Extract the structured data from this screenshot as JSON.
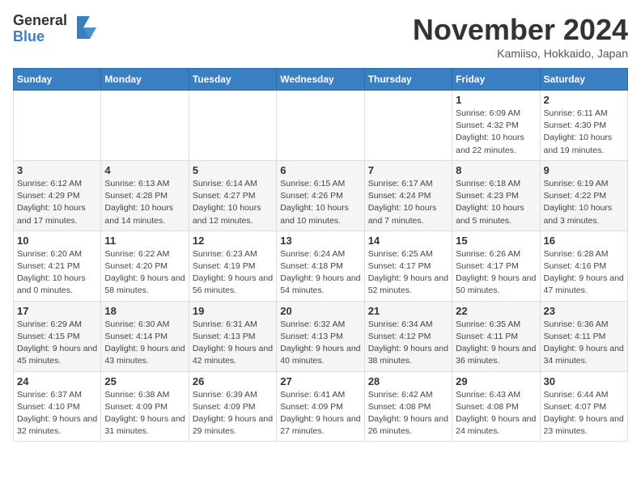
{
  "logo": {
    "general": "General",
    "blue": "Blue"
  },
  "title": "November 2024",
  "location": "Kamiiso, Hokkaido, Japan",
  "days_header": [
    "Sunday",
    "Monday",
    "Tuesday",
    "Wednesday",
    "Thursday",
    "Friday",
    "Saturday"
  ],
  "weeks": [
    [
      {
        "day": "",
        "info": ""
      },
      {
        "day": "",
        "info": ""
      },
      {
        "day": "",
        "info": ""
      },
      {
        "day": "",
        "info": ""
      },
      {
        "day": "",
        "info": ""
      },
      {
        "day": "1",
        "info": "Sunrise: 6:09 AM\nSunset: 4:32 PM\nDaylight: 10 hours and 22 minutes."
      },
      {
        "day": "2",
        "info": "Sunrise: 6:11 AM\nSunset: 4:30 PM\nDaylight: 10 hours and 19 minutes."
      }
    ],
    [
      {
        "day": "3",
        "info": "Sunrise: 6:12 AM\nSunset: 4:29 PM\nDaylight: 10 hours and 17 minutes."
      },
      {
        "day": "4",
        "info": "Sunrise: 6:13 AM\nSunset: 4:28 PM\nDaylight: 10 hours and 14 minutes."
      },
      {
        "day": "5",
        "info": "Sunrise: 6:14 AM\nSunset: 4:27 PM\nDaylight: 10 hours and 12 minutes."
      },
      {
        "day": "6",
        "info": "Sunrise: 6:15 AM\nSunset: 4:26 PM\nDaylight: 10 hours and 10 minutes."
      },
      {
        "day": "7",
        "info": "Sunrise: 6:17 AM\nSunset: 4:24 PM\nDaylight: 10 hours and 7 minutes."
      },
      {
        "day": "8",
        "info": "Sunrise: 6:18 AM\nSunset: 4:23 PM\nDaylight: 10 hours and 5 minutes."
      },
      {
        "day": "9",
        "info": "Sunrise: 6:19 AM\nSunset: 4:22 PM\nDaylight: 10 hours and 3 minutes."
      }
    ],
    [
      {
        "day": "10",
        "info": "Sunrise: 6:20 AM\nSunset: 4:21 PM\nDaylight: 10 hours and 0 minutes."
      },
      {
        "day": "11",
        "info": "Sunrise: 6:22 AM\nSunset: 4:20 PM\nDaylight: 9 hours and 58 minutes."
      },
      {
        "day": "12",
        "info": "Sunrise: 6:23 AM\nSunset: 4:19 PM\nDaylight: 9 hours and 56 minutes."
      },
      {
        "day": "13",
        "info": "Sunrise: 6:24 AM\nSunset: 4:18 PM\nDaylight: 9 hours and 54 minutes."
      },
      {
        "day": "14",
        "info": "Sunrise: 6:25 AM\nSunset: 4:17 PM\nDaylight: 9 hours and 52 minutes."
      },
      {
        "day": "15",
        "info": "Sunrise: 6:26 AM\nSunset: 4:17 PM\nDaylight: 9 hours and 50 minutes."
      },
      {
        "day": "16",
        "info": "Sunrise: 6:28 AM\nSunset: 4:16 PM\nDaylight: 9 hours and 47 minutes."
      }
    ],
    [
      {
        "day": "17",
        "info": "Sunrise: 6:29 AM\nSunset: 4:15 PM\nDaylight: 9 hours and 45 minutes."
      },
      {
        "day": "18",
        "info": "Sunrise: 6:30 AM\nSunset: 4:14 PM\nDaylight: 9 hours and 43 minutes."
      },
      {
        "day": "19",
        "info": "Sunrise: 6:31 AM\nSunset: 4:13 PM\nDaylight: 9 hours and 42 minutes."
      },
      {
        "day": "20",
        "info": "Sunrise: 6:32 AM\nSunset: 4:13 PM\nDaylight: 9 hours and 40 minutes."
      },
      {
        "day": "21",
        "info": "Sunrise: 6:34 AM\nSunset: 4:12 PM\nDaylight: 9 hours and 38 minutes."
      },
      {
        "day": "22",
        "info": "Sunrise: 6:35 AM\nSunset: 4:11 PM\nDaylight: 9 hours and 36 minutes."
      },
      {
        "day": "23",
        "info": "Sunrise: 6:36 AM\nSunset: 4:11 PM\nDaylight: 9 hours and 34 minutes."
      }
    ],
    [
      {
        "day": "24",
        "info": "Sunrise: 6:37 AM\nSunset: 4:10 PM\nDaylight: 9 hours and 32 minutes."
      },
      {
        "day": "25",
        "info": "Sunrise: 6:38 AM\nSunset: 4:09 PM\nDaylight: 9 hours and 31 minutes."
      },
      {
        "day": "26",
        "info": "Sunrise: 6:39 AM\nSunset: 4:09 PM\nDaylight: 9 hours and 29 minutes."
      },
      {
        "day": "27",
        "info": "Sunrise: 6:41 AM\nSunset: 4:09 PM\nDaylight: 9 hours and 27 minutes."
      },
      {
        "day": "28",
        "info": "Sunrise: 6:42 AM\nSunset: 4:08 PM\nDaylight: 9 hours and 26 minutes."
      },
      {
        "day": "29",
        "info": "Sunrise: 6:43 AM\nSunset: 4:08 PM\nDaylight: 9 hours and 24 minutes."
      },
      {
        "day": "30",
        "info": "Sunrise: 6:44 AM\nSunset: 4:07 PM\nDaylight: 9 hours and 23 minutes."
      }
    ]
  ]
}
